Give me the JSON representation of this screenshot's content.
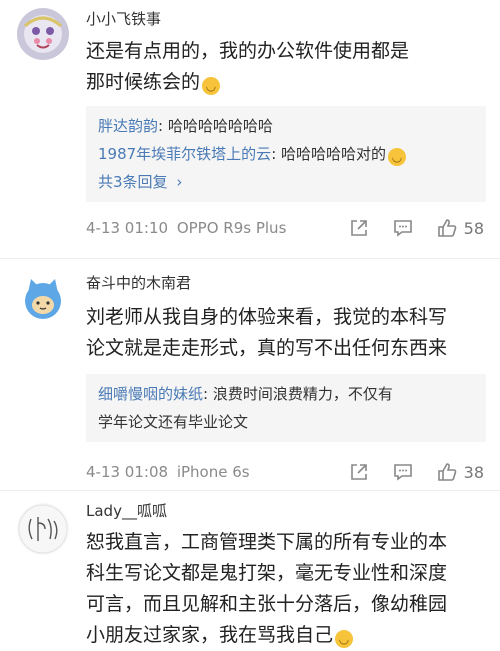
{
  "comments": [
    {
      "username": "小小飞铁事",
      "text_lines": [
        "还是有点用的，我的办公软件使用都是",
        "那时候练会的"
      ],
      "replies": [
        {
          "user": "胖达韵韵",
          "text": "哈哈哈哈哈哈哈"
        },
        {
          "user": "1987年埃菲尔铁塔上的云",
          "text": "哈哈哈哈哈对的"
        }
      ],
      "more_replies": "共3条回复",
      "date": "4-13 01:10",
      "device": "OPPO R9s Plus",
      "likes": "58"
    },
    {
      "username": "奋斗中的木南君",
      "text_lines": [
        "刘老师从我自身的体验来看，我觉的本科写",
        "论文就是走走形式，真的写不出任何东西来"
      ],
      "reply": {
        "user": "细嚼慢咽的妹纸",
        "text_line1": "浪费时间浪费精力，不仅有",
        "text_line2": "学年论文还有毕业论文"
      },
      "date": "4-13 01:08",
      "device": "iPhone 6s",
      "likes": "38"
    },
    {
      "username": "Lady__呱呱",
      "text_lines": [
        "恕我直言，工商管理类下属的所有专业的本",
        "科生写论文都是鬼打架，毫无专业性和深度",
        "可言，而且见解和主张十分落后，像幼稚园",
        "小朋友过家家，我在骂我自己"
      ]
    }
  ],
  "icons": {
    "share": "share-icon",
    "comment": "comment-icon",
    "like": "thumbs-up-icon",
    "more": "chevron-right-icon"
  },
  "colors": {
    "link": "#4a7ab5",
    "meta": "#8a8a8a",
    "reply_bg": "#f5f5f5"
  }
}
